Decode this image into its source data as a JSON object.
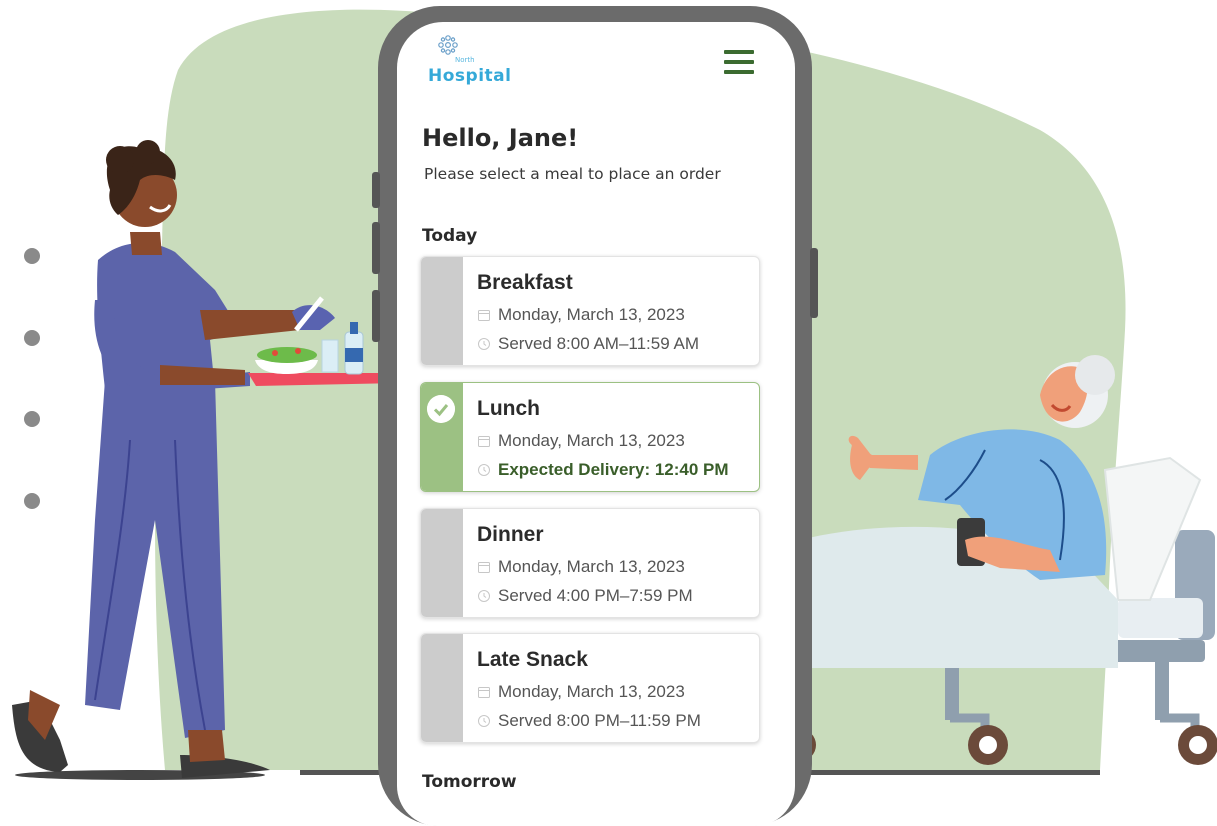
{
  "app": {
    "logo_small": "North",
    "logo_text": "Hospital"
  },
  "greeting": "Hello, Jane!",
  "subtitle": "Please select a meal to place an order",
  "sections": {
    "today": "Today",
    "tomorrow": "Tomorrow"
  },
  "meals": [
    {
      "name": "Breakfast",
      "date": "Monday, March 13, 2023",
      "info": "Served 8:00 AM–11:59 AM",
      "selected": false
    },
    {
      "name": "Lunch",
      "date": "Monday, March 13, 2023",
      "info": "Expected Delivery: 12:40 PM",
      "selected": true
    },
    {
      "name": "Dinner",
      "date": "Monday, March 13, 2023",
      "info": "Served 4:00 PM–7:59 PM",
      "selected": false
    },
    {
      "name": "Late Snack",
      "date": "Monday, March 13, 2023",
      "info": "Served 8:00 PM–11:59 PM",
      "selected": false
    }
  ],
  "colors": {
    "background_blob": "#c9dcbc",
    "accent_green": "#9cc183",
    "menu_icon": "#3b6b30",
    "logo_blue": "#35a9d8"
  },
  "icons": {
    "menu": "hamburger-menu-icon",
    "date": "calendar-icon",
    "time": "clock-icon",
    "selected": "checkmark-icon"
  }
}
